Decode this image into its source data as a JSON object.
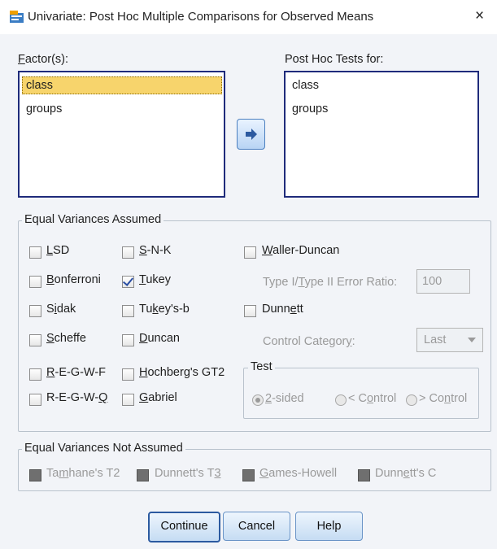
{
  "window": {
    "title": "Univariate: Post Hoc Multiple Comparisons for Observed Means",
    "close_glyph": "×"
  },
  "factors": {
    "label_u": "F",
    "label_rest": "actor(s):",
    "items": [
      "class",
      "groups"
    ],
    "selected": "class"
  },
  "targets": {
    "label": "Post Hoc Tests for:",
    "items": [
      "class",
      "groups"
    ]
  },
  "move_button_icon": "right-arrow-icon",
  "equal_assumed": {
    "legend": "Equal Variances Assumed",
    "lsd": {
      "u": "L",
      "rest": "SD",
      "checked": false
    },
    "bonferroni": {
      "u": "B",
      "rest": "onferroni",
      "checked": false
    },
    "sidak": {
      "pre": "S",
      "u": "i",
      "rest": "dak",
      "checked": false
    },
    "scheffe": {
      "u": "S",
      "rest": "cheffe",
      "checked": false
    },
    "regwf": {
      "u": "R",
      "rest": "-E-G-W-F",
      "checked": false
    },
    "regwq": {
      "pre": "R-E-G-W-",
      "u": "Q",
      "checked": false
    },
    "snk": {
      "u": "S",
      "rest": "-N-K",
      "checked": false
    },
    "tukey": {
      "u": "T",
      "rest": "ukey",
      "checked": true
    },
    "tukeyb": {
      "pre": "Tu",
      "u": "k",
      "rest": "ey's-b",
      "checked": false
    },
    "duncan": {
      "u": "D",
      "rest": "uncan",
      "checked": false
    },
    "hochberg": {
      "u": "H",
      "rest": "ochberg's GT2",
      "checked": false
    },
    "gabriel": {
      "u": "G",
      "rest": "abriel",
      "checked": false
    },
    "waller": {
      "u": "W",
      "rest": "aller-Duncan",
      "checked": false
    },
    "ratio_label": {
      "pre": "Type I/",
      "u": "T",
      "rest": "ype II Error Ratio:"
    },
    "ratio_value": "100",
    "dunnett": {
      "pre": "Dunn",
      "u": "e",
      "rest": "tt",
      "checked": false
    },
    "control_label": {
      "pre": "Control Categor",
      "u": "y",
      "rest": ":"
    },
    "control_value": "Last",
    "test_legend": "Test",
    "two_sided": {
      "u": "2",
      "rest": "-sided"
    },
    "lt_control": {
      "pre": "< C",
      "u": "o",
      "rest": "ntrol"
    },
    "gt_control": {
      "pre": "> Co",
      "u": "n",
      "rest": "trol"
    }
  },
  "equal_not_assumed": {
    "legend": "Equal Variances Not Assumed",
    "tamhane": {
      "pre": "Ta",
      "u": "m",
      "rest": "hane's T2"
    },
    "dunnett_t3": {
      "pre": "Dunnett's T",
      "u": "3"
    },
    "games_howell": {
      "u": "G",
      "rest": "ames-Howell"
    },
    "dunnett_c": {
      "pre": "Dunn",
      "u": "e",
      "rest": "tt's C"
    }
  },
  "buttons": {
    "continue": "Continue",
    "cancel": "Cancel",
    "help": "Help"
  },
  "colors": {
    "selection": "#f7d46c",
    "listbox_border": "#1f2b7b",
    "arrow": "#2c5aa0"
  }
}
